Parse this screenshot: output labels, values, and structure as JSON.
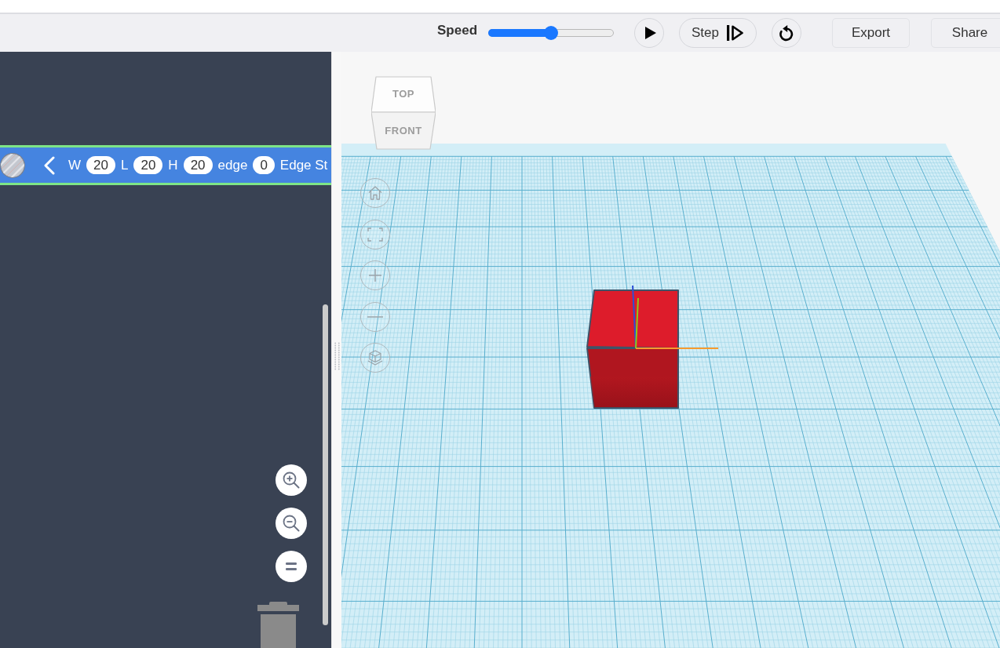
{
  "toolbar": {
    "speed": {
      "label": "Speed",
      "level": 0.5
    },
    "controls": [
      {
        "kind": "play"
      },
      {
        "kind": "step",
        "label": "Step"
      },
      {
        "kind": "restart"
      },
      {
        "kind": "export",
        "label": "Export"
      },
      {
        "kind": "share",
        "label": "Share"
      }
    ]
  },
  "workspace": {
    "block": {
      "fields": [
        {
          "label": "W",
          "value": "20"
        },
        {
          "label": "L",
          "value": "20"
        },
        {
          "label": "H",
          "value": "20"
        },
        {
          "label": "edge",
          "value": "0"
        }
      ],
      "trailing_label": "Edge St"
    },
    "zoom_controls": [
      {
        "kind": "zoomin"
      },
      {
        "kind": "zoomout"
      },
      {
        "kind": "reset"
      }
    ]
  },
  "viewport": {
    "view_cube": {
      "top_label": "TOP",
      "front_label": "FRONT"
    },
    "nav_buttons": [
      {
        "kind": "home"
      },
      {
        "kind": "fit"
      },
      {
        "kind": "zoomin"
      },
      {
        "kind": "zoomout"
      },
      {
        "kind": "perspective"
      }
    ]
  }
}
